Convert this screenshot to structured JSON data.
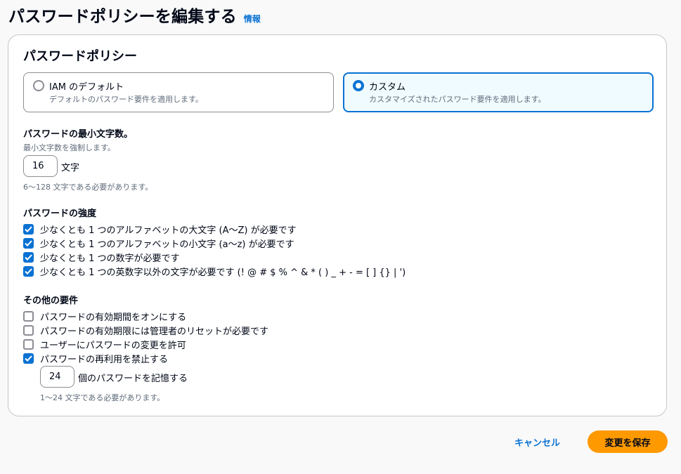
{
  "header": {
    "title": "パスワードポリシーを編集する",
    "info_link": "情報"
  },
  "container": {
    "title": "パスワードポリシー",
    "tiles": [
      {
        "label": "IAM のデフォルト",
        "description": "デフォルトのパスワード要件を適用します。",
        "selected": false
      },
      {
        "label": "カスタム",
        "description": "カスタマイズされたパスワード要件を適用します。",
        "selected": true
      }
    ],
    "min_length": {
      "label": "パスワードの最小文字数。",
      "description": "最小文字数を強制します。",
      "value": "16",
      "suffix": "文字",
      "constraint": "6〜128 文字である必要があります。"
    },
    "strength": {
      "label": "パスワードの強度",
      "items": [
        {
          "label": "少なくとも 1 つのアルファベットの大文字 (A〜Z) が必要です",
          "checked": true
        },
        {
          "label": "少なくとも 1 つのアルファベットの小文字 (a〜z) が必要です",
          "checked": true
        },
        {
          "label": "少なくとも 1 つの数字が必要です",
          "checked": true
        },
        {
          "label": "少なくとも 1 つの英数字以外の文字が必要です (! @ # $ % ^ & * ( ) _ + - = [ ] {} | ')",
          "checked": true
        }
      ]
    },
    "other": {
      "label": "その他の要件",
      "items": [
        {
          "label": "パスワードの有効期間をオンにする",
          "checked": false
        },
        {
          "label": "パスワードの有効期限には管理者のリセットが必要です",
          "checked": false
        },
        {
          "label": "ユーザーにパスワードの変更を許可",
          "checked": false
        },
        {
          "label": "パスワードの再利用を禁止する",
          "checked": true
        }
      ],
      "reuse_value": "24",
      "reuse_suffix": "個のパスワードを記憶する",
      "reuse_constraint": "1〜24 文字である必要があります。"
    }
  },
  "actions": {
    "cancel_label": "キャンセル",
    "save_label": "変更を保存"
  },
  "colors": {
    "accent": "#0972d3",
    "primary_button": "#ff9900",
    "selected_tile_bg": "#f0fbff"
  }
}
